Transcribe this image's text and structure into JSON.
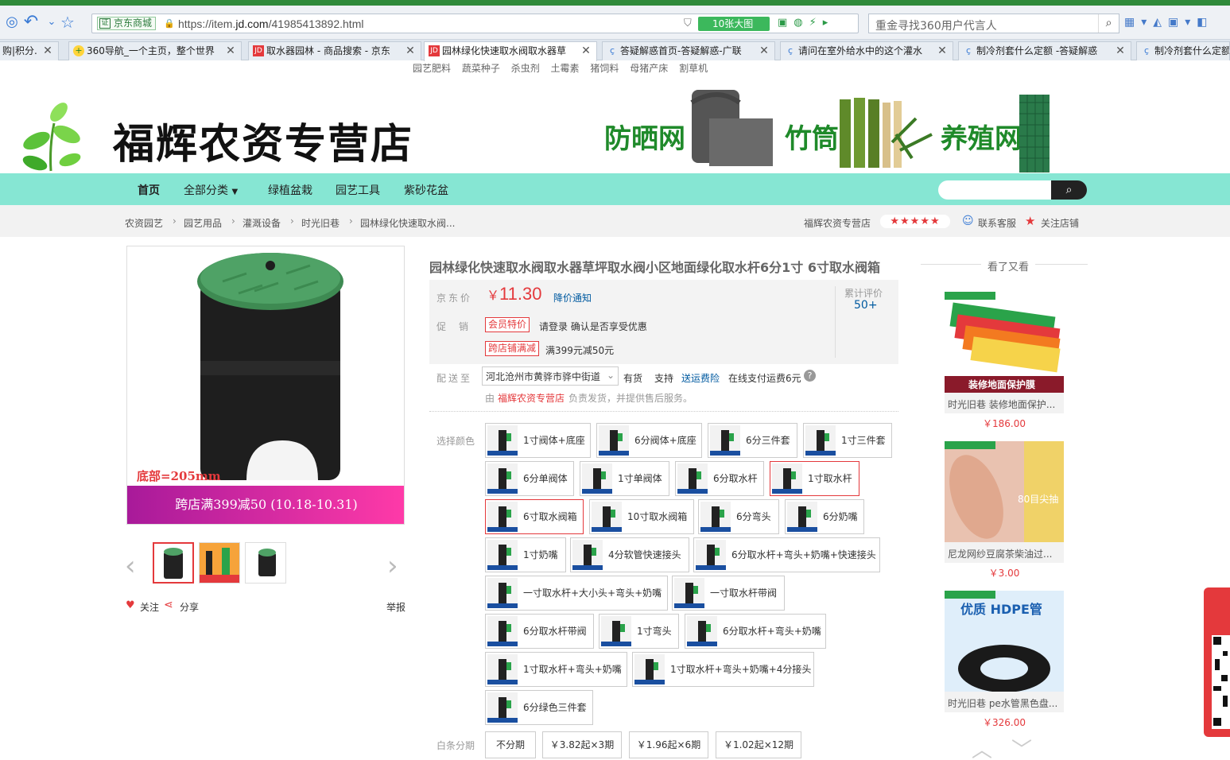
{
  "browser": {
    "site_badge": "京东商城",
    "url_prefix": "https://item.",
    "url_domain": "jd.com",
    "url_suffix": "/41985413892.html",
    "big_image_button": "10张大图",
    "search_placeholder": "重金寻找360用户代言人",
    "tabs": [
      {
        "label": "购|积分..."
      },
      {
        "label": "360导航_一个主页，整个世界"
      },
      {
        "label": "取水器园林 - 商品搜索 - 京东"
      },
      {
        "label": "园林绿化快速取水阀取水器草"
      },
      {
        "label": "答疑解惑首页-答疑解惑-广联"
      },
      {
        "label": "请问在室外给水中的这个灌水"
      },
      {
        "label": "制冷剂套什么定额 -答疑解惑"
      },
      {
        "label": "制冷剂套什么定额"
      }
    ]
  },
  "hotwords": [
    "园艺肥料",
    "蔬菜种子",
    "杀虫剂",
    "土霉素",
    "猪饲料",
    "母猪产床",
    "割草机"
  ],
  "store": {
    "name": "福辉农资专营店",
    "banner_words": [
      "防晒网",
      "竹筒",
      "养殖网"
    ]
  },
  "nav": {
    "items": [
      "首页",
      "全部分类",
      "绿植盆栽",
      "园艺工具",
      "紫砂花盆"
    ]
  },
  "breadcrumb": [
    "农资园艺",
    "园艺用品",
    "灌溉设备",
    "时光旧巷",
    "园林绿化快速取水阀..."
  ],
  "shop_info": {
    "name": "福辉农资专营店",
    "rating_stars": 5,
    "contact": "联系客服",
    "follow": "关注店铺"
  },
  "gallery": {
    "bottom_label": "底部=205mm",
    "promo": "跨店满399减50 (10.18-10.31)",
    "follow": "关注",
    "share": "分享",
    "report": "举报"
  },
  "product": {
    "title": "园林绿化快速取水阀取水器草坪取水阀小区地面绿化取水杆6分1寸 6寸取水阀箱",
    "price_label": "京东价",
    "currency": "￥",
    "price": "11.30",
    "price_notify": "降价通知",
    "review_label": "累计评价",
    "review_count": "50+",
    "promo_label": "促销",
    "promo_tag1": "会员特价",
    "promo_text1": "请登录 确认是否享受优惠",
    "promo_tag2": "跨店铺满减",
    "promo_text2": "满399元减50元",
    "delivery_label": "配送至",
    "delivery_address": "河北沧州市黄骅市骅中街道",
    "stock": "有货",
    "support": "支持",
    "insurance": "送运费险",
    "pay_text": "在线支付运费6元",
    "seller_prefix": "由",
    "seller_name": "福辉农资专营店",
    "seller_suffix": "负责发货，并提供售后服务。",
    "color_label": "选择颜色",
    "installment_label": "白条分期"
  },
  "sku_options": [
    "1寸阀体+底座",
    "6分阀体+底座",
    "6分三件套",
    "1寸三件套",
    "6分单阀体",
    "1寸单阀体",
    "6分取水杆",
    "1寸取水杆",
    "6寸取水阀箱",
    "10寸取水阀箱",
    "6分弯头",
    "6分奶嘴",
    "1寸奶嘴",
    "4分软管快速接头",
    "6分取水杆+弯头+奶嘴+快速接头",
    "一寸取水杆+大小头+弯头+奶嘴",
    "一寸取水杆带阀",
    "6分取水杆带阀",
    "1寸弯头",
    "6分取水杆+弯头+奶嘴",
    "1寸取水杆+弯头+奶嘴",
    "1寸取水杆+弯头+奶嘴+4分接头",
    "6分绿色三件套"
  ],
  "installments": [
    "不分期",
    "￥3.82起×3期",
    "￥1.96起×6期",
    "￥1.02起×12期"
  ],
  "recommend": {
    "title": "看了又看",
    "items": [
      {
        "title": "时光旧巷 装修地面保护...",
        "price": "￥186.00",
        "img_caption": "装修地面保护膜"
      },
      {
        "title": "尼龙网纱豆腐茶柴油过...",
        "price": "￥3.00",
        "img_caption": "80目尖抽"
      },
      {
        "title": "时光旧巷 pe水管黑色盘...",
        "price": "￥326.00",
        "img_caption": "优质 HDPE管"
      }
    ]
  }
}
